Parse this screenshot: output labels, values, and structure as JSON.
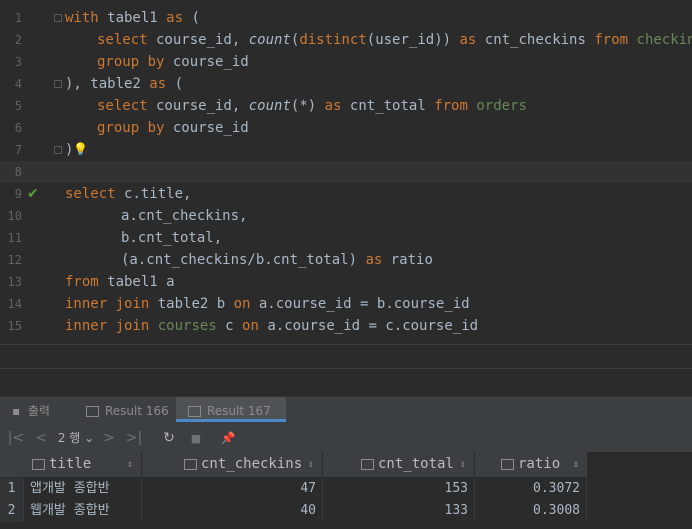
{
  "editor": {
    "lines": [
      {
        "n": "1"
      },
      {
        "n": "2"
      },
      {
        "n": "3"
      },
      {
        "n": "4"
      },
      {
        "n": "5"
      },
      {
        "n": "6"
      },
      {
        "n": "7"
      },
      {
        "n": "8"
      },
      {
        "n": "9"
      },
      {
        "n": "10"
      },
      {
        "n": "11"
      },
      {
        "n": "12"
      },
      {
        "n": "13"
      },
      {
        "n": "14"
      },
      {
        "n": "15"
      }
    ],
    "code": {
      "l1_with": "with",
      "l1_id": " tabel1 ",
      "l1_as": "as",
      "l1_p": " (",
      "l2_select": "select",
      "l2_a": " course_id, ",
      "l2_count": "count",
      "l2_b": "(",
      "l2_distinct": "distinct",
      "l2_c": "(user_id)) ",
      "l2_as": "as",
      "l2_d": " cnt_checkins ",
      "l2_from": "from",
      "l2_e": " ",
      "l2_tbl": "checkins",
      "l3_group": "group by",
      "l3_a": " course_id",
      "l4_a": "), table2 ",
      "l4_as": "as",
      "l4_b": " (",
      "l5_select": "select",
      "l5_a": " course_id, ",
      "l5_count": "count",
      "l5_b": "(*) ",
      "l5_as": "as",
      "l5_c": " cnt_total ",
      "l5_from": "from",
      "l5_d": " ",
      "l5_tbl": "orders",
      "l6_group": "group by",
      "l6_a": " course_id",
      "l7_a": ")",
      "l9_select": "select",
      "l9_a": " c.title,",
      "l10_a": "a.cnt_checkins,",
      "l11_a": "b.cnt_total,",
      "l12_a": "(a.cnt_checkins/b.cnt_total) ",
      "l12_as": "as",
      "l12_b": " ratio",
      "l13_from": "from",
      "l13_a": " tabel1 a",
      "l14_join": "inner join",
      "l14_a": " table2 b ",
      "l14_on": "on",
      "l14_b": " a.course_id = b.course_id",
      "l15_join": "inner join",
      "l15_a": " ",
      "l15_tbl": "courses",
      "l15_b": " c ",
      "l15_on": "on",
      "l15_c": " a.course_id = c.course_id"
    }
  },
  "tabs": [
    {
      "label": "출력"
    },
    {
      "label": "Result 166"
    },
    {
      "label": "Result 167"
    }
  ],
  "toolbar": {
    "first": "|<",
    "prev": "<",
    "rows_label": "2 행",
    "next": ">",
    "last": ">|",
    "refresh": "↻",
    "stop": "■",
    "pin": "📌"
  },
  "grid": {
    "columns": [
      {
        "label": "title"
      },
      {
        "label": "cnt_checkins"
      },
      {
        "label": "cnt_total"
      },
      {
        "label": "ratio"
      }
    ],
    "rows": [
      {
        "n": "1",
        "title": "앱개발 종합반",
        "cnt_checkins": "47",
        "cnt_total": "153",
        "ratio": "0.3072"
      },
      {
        "n": "2",
        "title": "웹개발 종합반",
        "cnt_checkins": "40",
        "cnt_total": "133",
        "ratio": "0.3008"
      }
    ]
  },
  "colors": {
    "keyword": "#cc7832",
    "identifier": "#a9b7c6",
    "table": "#6a8759",
    "accent": "#4a88c7",
    "check": "#5a9e3a"
  }
}
